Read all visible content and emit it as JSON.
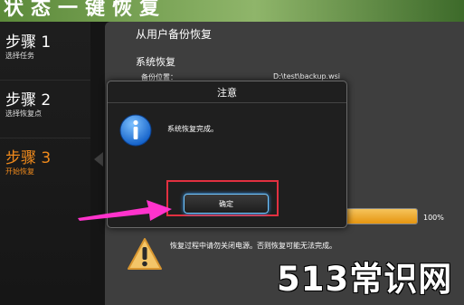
{
  "header": {
    "title": "状态一键恢复"
  },
  "sidebar": {
    "steps": [
      {
        "title": "步骤 1",
        "subtitle": "选择任务"
      },
      {
        "title": "步骤 2",
        "subtitle": "选择恢复点"
      },
      {
        "title": "步骤 3",
        "subtitle": "开始恢复"
      }
    ],
    "active_step_color": "#f08a1c"
  },
  "main": {
    "section_title": "从用户备份恢复",
    "subsection_title": "系统恢复",
    "backup_location_label": "备份位置：",
    "backup_location_value": "D:\\test\\backup.wsi",
    "progress": {
      "value": 1.0,
      "label": "100%",
      "fill_color": "#f0a21e"
    },
    "warning_text": "恢复过程中请勿关闭电源。否则恢复可能无法完成。"
  },
  "dialog": {
    "title": "注意",
    "message": "系统恢复完成。",
    "confirm_label": "确定",
    "highlight_color": "#e23040"
  },
  "annotation": {
    "arrow_color": "#ff33cc"
  },
  "watermark": {
    "text": "513常识网"
  },
  "icons": {
    "info": "info-icon",
    "warning": "warning-icon",
    "arrow": "annotation-arrow-icon"
  }
}
